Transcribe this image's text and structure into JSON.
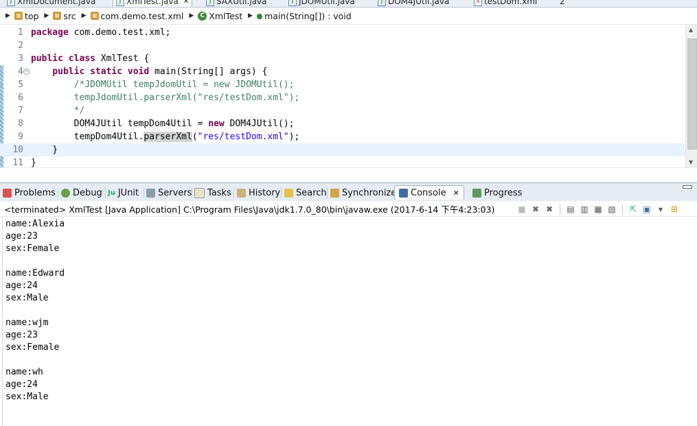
{
  "editor_tabs": [
    {
      "label": "XmlDocument.java",
      "active": false
    },
    {
      "label": "XmlTest.java",
      "active": true
    },
    {
      "label": "SAXUtil.java",
      "active": false
    },
    {
      "label": "JDOMUtil.java",
      "active": false
    },
    {
      "label": "DOM4JUtil.java",
      "active": false
    },
    {
      "label": "testDom.xml",
      "active": false
    },
    {
      "label": "2",
      "active": false
    }
  ],
  "breadcrumb": {
    "top": "top",
    "src": "src",
    "package": "com.demo.test.xml",
    "class": "XmlTest",
    "method": "main(String[]) : void"
  },
  "code_lines": [
    {
      "num": "1"
    },
    {
      "num": "2"
    },
    {
      "num": "3"
    },
    {
      "num": "4"
    },
    {
      "num": "5"
    },
    {
      "num": "6"
    },
    {
      "num": "7"
    },
    {
      "num": "8"
    },
    {
      "num": "9"
    },
    {
      "num": "10"
    },
    {
      "num": "11"
    }
  ],
  "code": {
    "l1_kw": "package",
    "l1_rest": " com.demo.test.xml;",
    "l3_kw1": "public",
    "l3_kw2": "class",
    "l3_rest": " XmlTest {",
    "l4_indent": "    ",
    "l4_kw1": "public",
    "l4_kw2": "static",
    "l4_kw3": "void",
    "l4_rest": " main(String[] args) {",
    "l5_comment": "        /*JDOMUtil tempJdomUtil = new JDOMUtil();",
    "l6_comment": "        tempJdomUtil.parserXml(\"res/testDom.xml\");",
    "l7_comment": "        */",
    "l8_pre": "        DOM4JUtil tempDom4Util = ",
    "l8_kw": "new",
    "l8_post": " DOM4JUtil();",
    "l9_pre": "        tempDom4Util.",
    "l9_hl": "parserXml",
    "l9_paren": "(",
    "l9_str": "\"res/testDom.xml\"",
    "l9_post": ");",
    "l10": "    }",
    "l11": "}"
  },
  "view_tabs": [
    {
      "label": "Problems"
    },
    {
      "label": "Debug"
    },
    {
      "label": "JUnit"
    },
    {
      "label": "Servers"
    },
    {
      "label": "Tasks"
    },
    {
      "label": "History"
    },
    {
      "label": "Search"
    },
    {
      "label": "Synchronize"
    },
    {
      "label": "Console"
    },
    {
      "label": "Progress"
    }
  ],
  "console": {
    "header": "<terminated> XmlTest [Java Application] C:\\Program Files\\Java\\jdk1.7.0_80\\bin\\javaw.exe (2017-6-14 下午4:23:03)",
    "output": [
      "name:Alexia",
      "age:23",
      "sex:Female",
      "",
      "name:Edward",
      "age:24",
      "sex:Male",
      "",
      "name:wjm",
      "age:23",
      "sex:Female",
      "",
      "name:wh",
      "age:24",
      "sex:Male"
    ]
  },
  "icons": {
    "class": "class-icon",
    "method": "method-icon",
    "package": "package-icon",
    "folder": "folder-icon"
  },
  "colors": {
    "keyword": "#7f0055",
    "comment": "#3f7f5f",
    "string": "#2a00ff",
    "current_line": "#e8f2fe"
  }
}
